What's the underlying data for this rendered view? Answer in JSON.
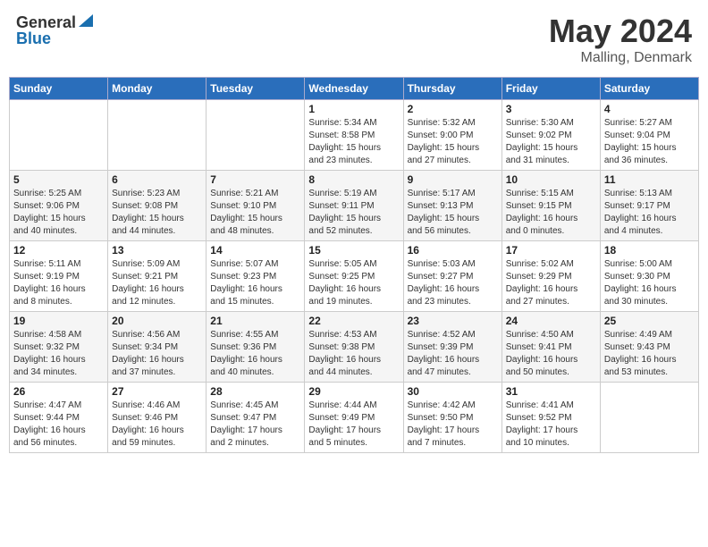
{
  "header": {
    "logo_general": "General",
    "logo_blue": "Blue",
    "title": "May 2024",
    "location": "Malling, Denmark"
  },
  "weekdays": [
    "Sunday",
    "Monday",
    "Tuesday",
    "Wednesday",
    "Thursday",
    "Friday",
    "Saturday"
  ],
  "weeks": [
    [
      {
        "day": "",
        "info": ""
      },
      {
        "day": "",
        "info": ""
      },
      {
        "day": "",
        "info": ""
      },
      {
        "day": "1",
        "info": "Sunrise: 5:34 AM\nSunset: 8:58 PM\nDaylight: 15 hours\nand 23 minutes."
      },
      {
        "day": "2",
        "info": "Sunrise: 5:32 AM\nSunset: 9:00 PM\nDaylight: 15 hours\nand 27 minutes."
      },
      {
        "day": "3",
        "info": "Sunrise: 5:30 AM\nSunset: 9:02 PM\nDaylight: 15 hours\nand 31 minutes."
      },
      {
        "day": "4",
        "info": "Sunrise: 5:27 AM\nSunset: 9:04 PM\nDaylight: 15 hours\nand 36 minutes."
      }
    ],
    [
      {
        "day": "5",
        "info": "Sunrise: 5:25 AM\nSunset: 9:06 PM\nDaylight: 15 hours\nand 40 minutes."
      },
      {
        "day": "6",
        "info": "Sunrise: 5:23 AM\nSunset: 9:08 PM\nDaylight: 15 hours\nand 44 minutes."
      },
      {
        "day": "7",
        "info": "Sunrise: 5:21 AM\nSunset: 9:10 PM\nDaylight: 15 hours\nand 48 minutes."
      },
      {
        "day": "8",
        "info": "Sunrise: 5:19 AM\nSunset: 9:11 PM\nDaylight: 15 hours\nand 52 minutes."
      },
      {
        "day": "9",
        "info": "Sunrise: 5:17 AM\nSunset: 9:13 PM\nDaylight: 15 hours\nand 56 minutes."
      },
      {
        "day": "10",
        "info": "Sunrise: 5:15 AM\nSunset: 9:15 PM\nDaylight: 16 hours\nand 0 minutes."
      },
      {
        "day": "11",
        "info": "Sunrise: 5:13 AM\nSunset: 9:17 PM\nDaylight: 16 hours\nand 4 minutes."
      }
    ],
    [
      {
        "day": "12",
        "info": "Sunrise: 5:11 AM\nSunset: 9:19 PM\nDaylight: 16 hours\nand 8 minutes."
      },
      {
        "day": "13",
        "info": "Sunrise: 5:09 AM\nSunset: 9:21 PM\nDaylight: 16 hours\nand 12 minutes."
      },
      {
        "day": "14",
        "info": "Sunrise: 5:07 AM\nSunset: 9:23 PM\nDaylight: 16 hours\nand 15 minutes."
      },
      {
        "day": "15",
        "info": "Sunrise: 5:05 AM\nSunset: 9:25 PM\nDaylight: 16 hours\nand 19 minutes."
      },
      {
        "day": "16",
        "info": "Sunrise: 5:03 AM\nSunset: 9:27 PM\nDaylight: 16 hours\nand 23 minutes."
      },
      {
        "day": "17",
        "info": "Sunrise: 5:02 AM\nSunset: 9:29 PM\nDaylight: 16 hours\nand 27 minutes."
      },
      {
        "day": "18",
        "info": "Sunrise: 5:00 AM\nSunset: 9:30 PM\nDaylight: 16 hours\nand 30 minutes."
      }
    ],
    [
      {
        "day": "19",
        "info": "Sunrise: 4:58 AM\nSunset: 9:32 PM\nDaylight: 16 hours\nand 34 minutes."
      },
      {
        "day": "20",
        "info": "Sunrise: 4:56 AM\nSunset: 9:34 PM\nDaylight: 16 hours\nand 37 minutes."
      },
      {
        "day": "21",
        "info": "Sunrise: 4:55 AM\nSunset: 9:36 PM\nDaylight: 16 hours\nand 40 minutes."
      },
      {
        "day": "22",
        "info": "Sunrise: 4:53 AM\nSunset: 9:38 PM\nDaylight: 16 hours\nand 44 minutes."
      },
      {
        "day": "23",
        "info": "Sunrise: 4:52 AM\nSunset: 9:39 PM\nDaylight: 16 hours\nand 47 minutes."
      },
      {
        "day": "24",
        "info": "Sunrise: 4:50 AM\nSunset: 9:41 PM\nDaylight: 16 hours\nand 50 minutes."
      },
      {
        "day": "25",
        "info": "Sunrise: 4:49 AM\nSunset: 9:43 PM\nDaylight: 16 hours\nand 53 minutes."
      }
    ],
    [
      {
        "day": "26",
        "info": "Sunrise: 4:47 AM\nSunset: 9:44 PM\nDaylight: 16 hours\nand 56 minutes."
      },
      {
        "day": "27",
        "info": "Sunrise: 4:46 AM\nSunset: 9:46 PM\nDaylight: 16 hours\nand 59 minutes."
      },
      {
        "day": "28",
        "info": "Sunrise: 4:45 AM\nSunset: 9:47 PM\nDaylight: 17 hours\nand 2 minutes."
      },
      {
        "day": "29",
        "info": "Sunrise: 4:44 AM\nSunset: 9:49 PM\nDaylight: 17 hours\nand 5 minutes."
      },
      {
        "day": "30",
        "info": "Sunrise: 4:42 AM\nSunset: 9:50 PM\nDaylight: 17 hours\nand 7 minutes."
      },
      {
        "day": "31",
        "info": "Sunrise: 4:41 AM\nSunset: 9:52 PM\nDaylight: 17 hours\nand 10 minutes."
      },
      {
        "day": "",
        "info": ""
      }
    ]
  ]
}
